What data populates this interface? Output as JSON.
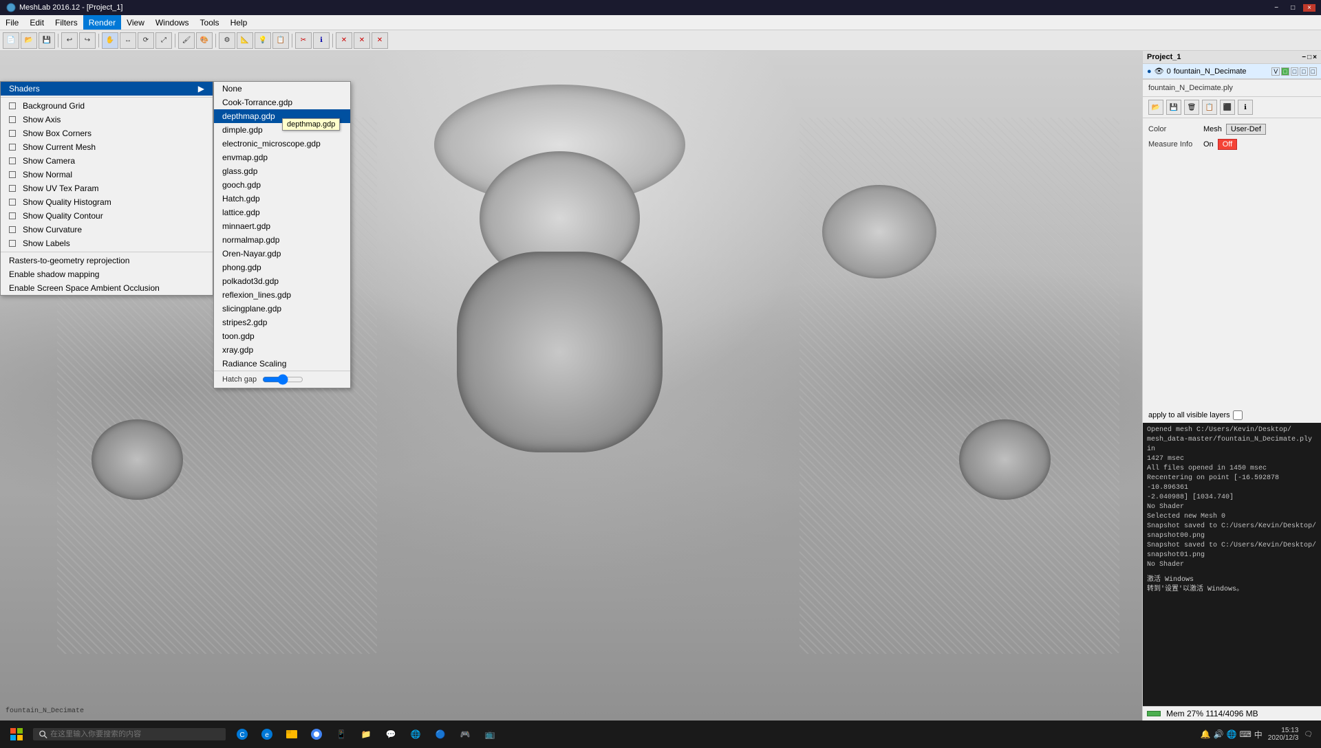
{
  "window": {
    "title": "MeshLab 2016.12 - [Project_1]",
    "controls": [
      "−",
      "□",
      "×"
    ]
  },
  "menubar": {
    "items": [
      "File",
      "Edit",
      "Filters",
      "Render",
      "View",
      "Windows",
      "Tools",
      "Help"
    ]
  },
  "toolbar": {
    "buttons": [
      "📂",
      "💾",
      "🖨",
      "✂",
      "📋",
      "↩",
      "↪",
      "🔍",
      "🔍+",
      "🔍-",
      "⟳",
      "⬛",
      "🎨",
      "⚙",
      "📐",
      "📏",
      "⚙",
      "ℹ",
      "❌",
      "❌",
      "❌"
    ]
  },
  "render_menu": {
    "items": [
      {
        "label": "Shaders",
        "has_sub": true,
        "active": false
      },
      {
        "label": "Background Grid",
        "checkbox": true,
        "checked": false
      },
      {
        "label": "Show Axis",
        "checkbox": true,
        "checked": false
      },
      {
        "label": "Show Box Corners",
        "checkbox": true,
        "checked": false
      },
      {
        "label": "Show Current Mesh",
        "checkbox": true,
        "checked": false
      },
      {
        "label": "Show Camera",
        "checkbox": true,
        "checked": false
      },
      {
        "label": "Show Normal",
        "checkbox": true,
        "checked": false
      },
      {
        "label": "Show UV Tex Param",
        "checkbox": true,
        "checked": false
      },
      {
        "label": "Show Quality Histogram",
        "checkbox": true,
        "checked": false
      },
      {
        "label": "Show Quality Contour",
        "checkbox": true,
        "checked": false
      },
      {
        "label": "Show Curvature",
        "checkbox": true,
        "checked": false
      },
      {
        "label": "Show Labels",
        "checkbox": true,
        "checked": false
      },
      {
        "label": "Rasters-to-geometry reprojection",
        "checkbox": false
      },
      {
        "label": "Enable shadow mapping",
        "checkbox": false
      },
      {
        "label": "Enable Screen Space Ambient Occlusion",
        "checkbox": false
      }
    ]
  },
  "shaders_menu": {
    "items": [
      {
        "label": "None",
        "selected": false
      },
      {
        "label": "Cook-Torrance.gdp",
        "selected": false
      },
      {
        "label": "depthmap.gdp",
        "selected": true
      },
      {
        "label": "dimple.gdp",
        "selected": false
      },
      {
        "label": "electronic_microscope.gdp",
        "selected": false
      },
      {
        "label": "envmap.gdp",
        "selected": false
      },
      {
        "label": "glass.gdp",
        "selected": false
      },
      {
        "label": "gooch.gdp",
        "selected": false
      },
      {
        "label": "Hatch.gdp",
        "selected": false
      },
      {
        "label": "lattice.gdp",
        "selected": false
      },
      {
        "label": "minnaert.gdp",
        "selected": false
      },
      {
        "label": "normalmap.gdp",
        "selected": false
      },
      {
        "label": "Oren-Nayar.gdp",
        "selected": false
      },
      {
        "label": "phong.gdp",
        "selected": false
      },
      {
        "label": "polkadot3d.gdp",
        "selected": false
      },
      {
        "label": "reflexion_lines.gdp",
        "selected": false
      },
      {
        "label": "slicingplane.gdp",
        "selected": false
      },
      {
        "label": "stripes2.gdp",
        "selected": false
      },
      {
        "label": "toon.gdp",
        "selected": false
      },
      {
        "label": "xray.gdp",
        "selected": false
      },
      {
        "label": "Radiance Scaling",
        "selected": false
      }
    ]
  },
  "hatch_gap_label": "Hatch gap",
  "tooltip_text": "depthmap.gdp",
  "right_panel": {
    "title": "Project_1",
    "layer": {
      "index": "0",
      "name": "fountain_N_Decimate"
    },
    "filename": "fountain_N_Decimate.ply",
    "color_label": "Color",
    "mesh_label": "Mesh",
    "mesh_value": "User-Def",
    "measure_label": "Measure Info",
    "on_label": "On",
    "off_label": "Off",
    "apply_label": "apply to all visible layers"
  },
  "console": {
    "lines": [
      "Opened mesh C:/Users/Kevin/Desktop/",
      "mesh_data-master/fountain_N_Decimate.ply in",
      "1427 msec",
      "All files opened in 1450 msec",
      "Recentering on point [-16.592878 -10.896361",
      "-2.040988] [1034.740]",
      "No Shader",
      "Selected new Mesh 0",
      "Snapshot saved to C:/Users/Kevin/Desktop/",
      "snapshot00.png",
      "Snapshot saved to C:/Users/Kevin/Desktop/",
      "snapshot01.png",
      "No Shader"
    ]
  },
  "statusbar": {
    "progress_label": "Mem 27% 1114/4096 MB"
  },
  "taskbar": {
    "search_placeholder": "在这里输入你要搜索的内容",
    "time": "15:13",
    "date": "2020/12/3",
    "mem_text": "Mem 27% 1114/4096 MB",
    "activate_windows": "激活 Windows",
    "activate_sub": "转到'设置'以激活 Windows。"
  }
}
